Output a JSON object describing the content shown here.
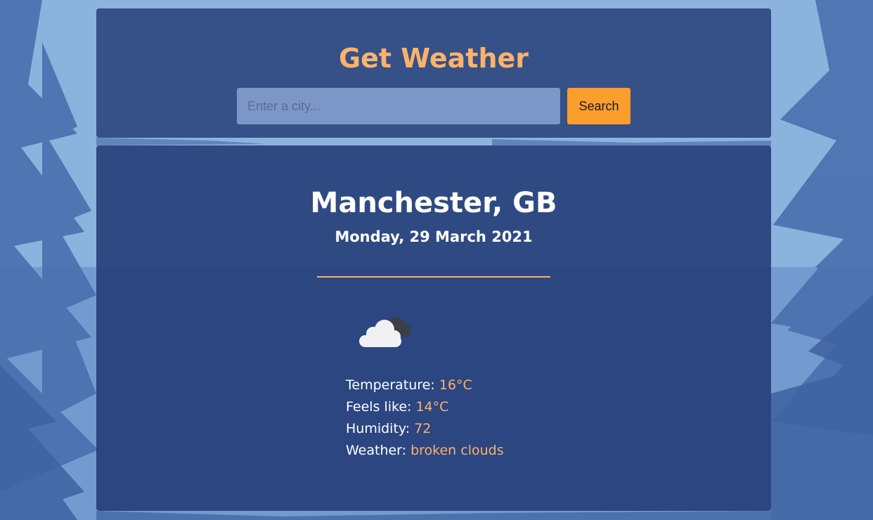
{
  "header": {
    "title": "Get Weather"
  },
  "search": {
    "placeholder": "Enter a city...",
    "value": "",
    "button_label": "Search"
  },
  "weather": {
    "location": "Manchester, GB",
    "date": "Monday, 29 March 2021",
    "icon": "broken-clouds-icon",
    "stats": [
      {
        "label": "Temperature:",
        "value": "16°C"
      },
      {
        "label": "Feels like:",
        "value": "14°C"
      },
      {
        "label": "Humidity:",
        "value": "72"
      },
      {
        "label": "Weather:",
        "value": "broken clouds"
      }
    ]
  },
  "colors": {
    "accent": "#fbb26a",
    "button": "#fb9e2c",
    "card": "#233a75",
    "text": "#ffffff"
  }
}
